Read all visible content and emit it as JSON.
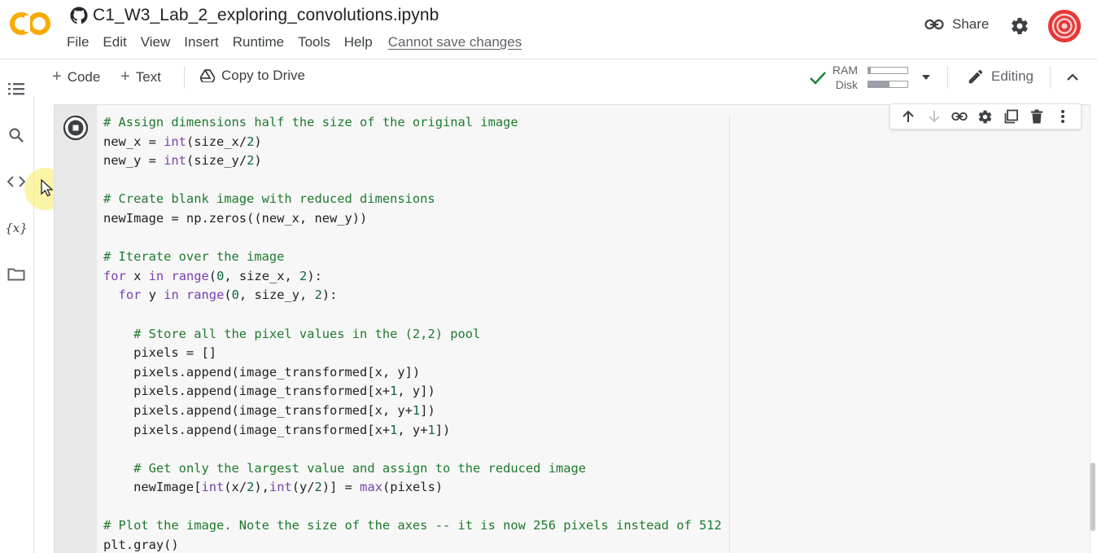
{
  "header": {
    "notebook_title": "C1_W3_Lab_2_exploring_convolutions.ipynb",
    "logo_text": "CO",
    "menu": [
      "File",
      "Edit",
      "View",
      "Insert",
      "Runtime",
      "Tools",
      "Help"
    ],
    "cannot_save": "Cannot save changes",
    "share_label": "Share"
  },
  "toolbar": {
    "code_label": "Code",
    "text_label": "Text",
    "copy_drive_label": "Copy to Drive",
    "ram_label": "RAM",
    "disk_label": "Disk",
    "ram_usage": 0.06,
    "disk_usage": 0.55,
    "editing_label": "Editing"
  },
  "rail": {
    "icons": [
      "table-of-contents-icon",
      "search-icon",
      "code-snippets-icon",
      "variables-icon",
      "folder-icon"
    ]
  },
  "cell": {
    "lines": [
      "# Assign dimensions half the size of the original image",
      "new_x = int(size_x/2)",
      "new_y = int(size_y/2)",
      "",
      "# Create blank image with reduced dimensions",
      "newImage = np.zeros((new_x, new_y))",
      "",
      "# Iterate over the image",
      "for x in range(0, size_x, 2):",
      "  for y in range(0, size_y, 2):",
      "",
      "    # Store all the pixel values in the (2,2) pool",
      "    pixels = []",
      "    pixels.append(image_transformed[x, y])",
      "    pixels.append(image_transformed[x+1, y])",
      "    pixels.append(image_transformed[x, y+1])",
      "    pixels.append(image_transformed[x+1, y+1])",
      "",
      "    # Get only the largest value and assign to the reduced image",
      "    newImage[int(x/2),int(y/2)] = max(pixels)",
      "",
      "# Plot the image. Note the size of the axes -- it is now 256 pixels instead of 512",
      "plt.gray()"
    ]
  },
  "colors": {
    "logo_orange": "#f9ab00",
    "comment_green": "#1e7a2d",
    "keyword_purple": "#7b3fb3",
    "check_green": "#188038",
    "avatar_red": "#e53935"
  }
}
